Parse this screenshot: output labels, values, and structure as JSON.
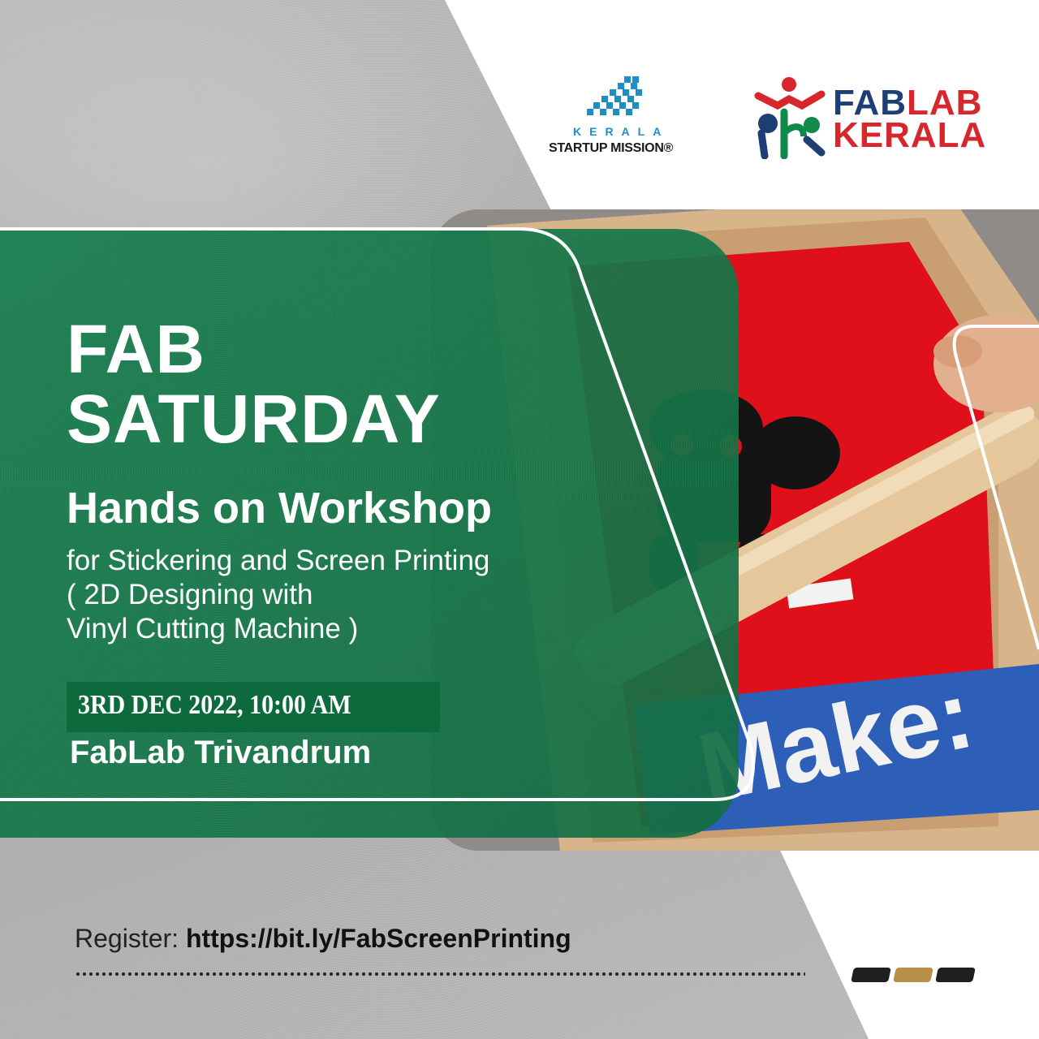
{
  "logos": {
    "ksum": {
      "line1": "KERALA",
      "line2": "STARTUP MISSION®"
    },
    "fablab": {
      "line1_a": "FAB",
      "line1_b": "LAB",
      "line2": "KERALA"
    }
  },
  "event": {
    "title_line1": "FAB",
    "title_line2": "SATURDAY",
    "headline": "Hands on Workshop",
    "sub_line1": "for Stickering and Screen Printing",
    "sub_line2": "( 2D Designing with",
    "sub_line3": "Vinyl Cutting Machine )",
    "date": "3RD DEC 2022, 10:00 AM",
    "venue": "FabLab Trivandrum"
  },
  "photo": {
    "screen_text": "Make:"
  },
  "register": {
    "label": "Register:",
    "url": "https://bit.ly/FabScreenPrinting"
  },
  "colors": {
    "green": "#14804e",
    "fablab_blue": "#1e3f73",
    "fablab_red": "#d7262c",
    "ksum_blue": "#1c8fc9",
    "pill_dark": "#1f1f1f",
    "pill_gold": "#b9904a"
  }
}
